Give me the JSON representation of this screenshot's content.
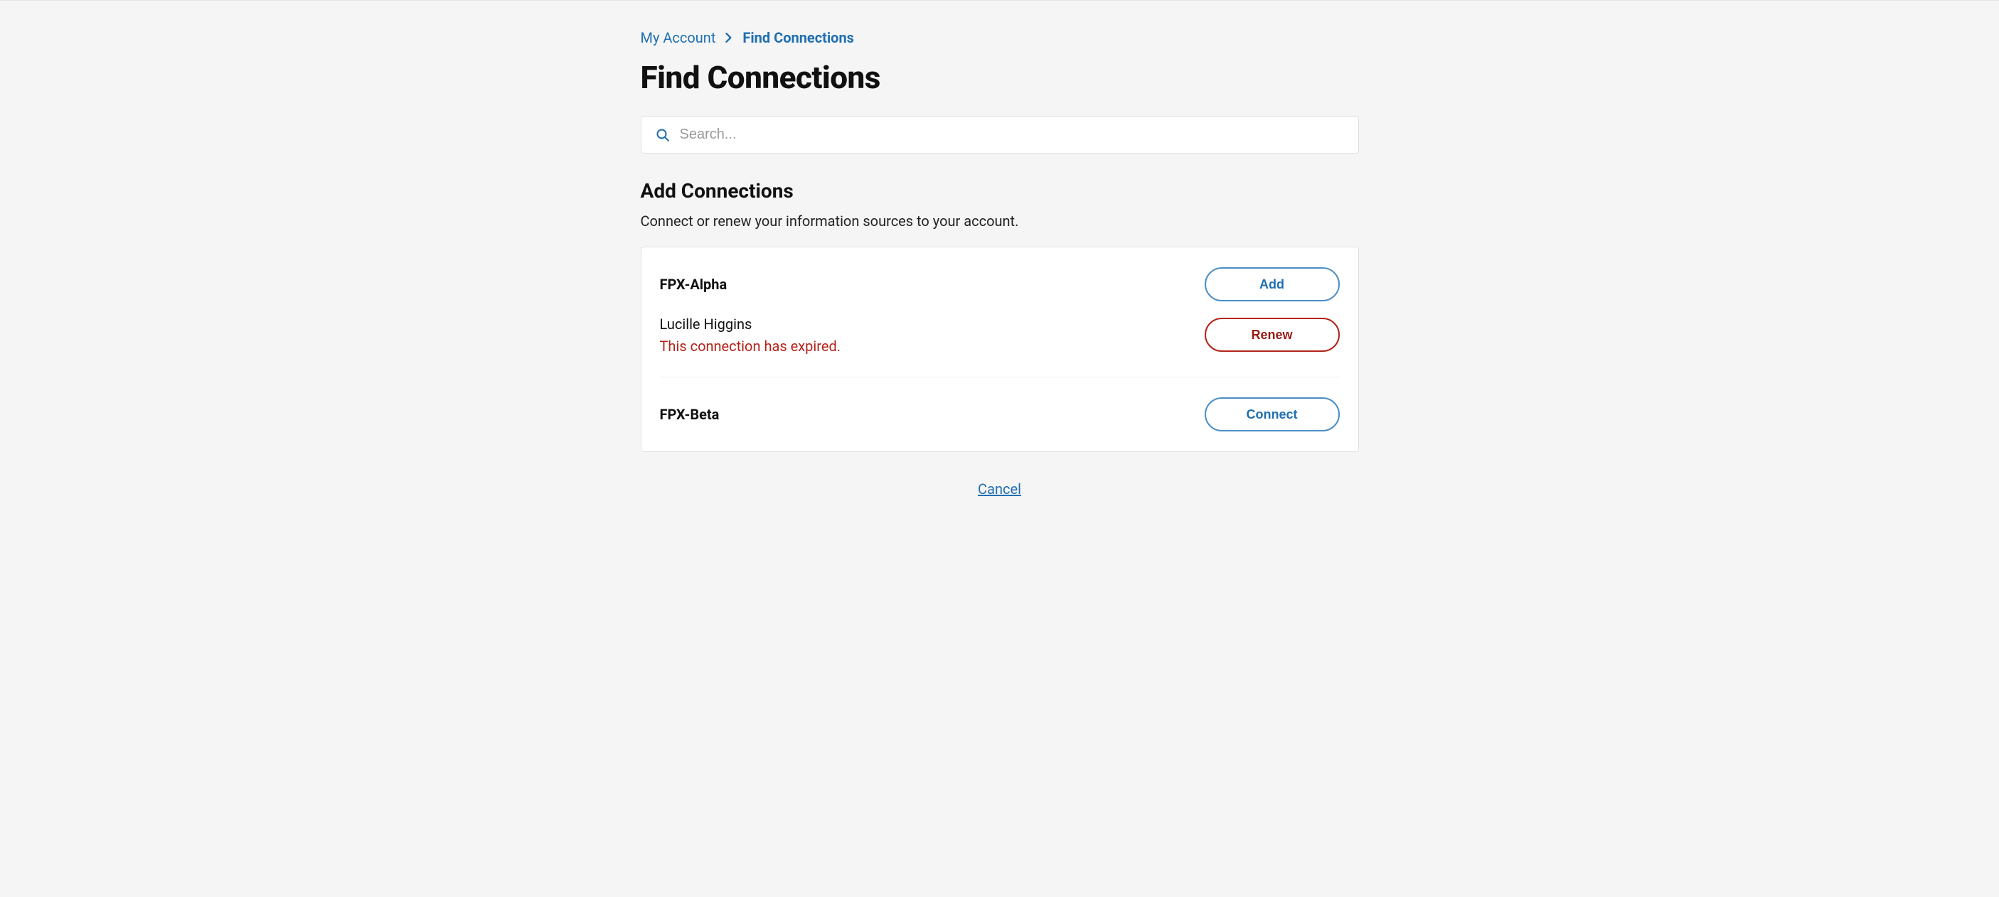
{
  "breadcrumb": {
    "parent": "My Account",
    "current": "Find Connections"
  },
  "page": {
    "title": "Find Connections"
  },
  "search": {
    "placeholder": "Search..."
  },
  "section": {
    "title": "Add Connections",
    "description": "Connect or renew your information sources to your account."
  },
  "connections": [
    {
      "title": "FPX-Alpha",
      "actions": {
        "primary_label": "Add",
        "primary_style": "blue"
      },
      "members": [
        {
          "name": "Lucille Higgins",
          "status_text": "This connection has expired.",
          "status_kind": "expired",
          "action_label": "Renew",
          "action_style": "red"
        }
      ]
    },
    {
      "title": "FPX-Beta",
      "actions": {
        "primary_label": "Connect",
        "primary_style": "blue"
      },
      "members": []
    }
  ],
  "footer": {
    "cancel_label": "Cancel"
  }
}
